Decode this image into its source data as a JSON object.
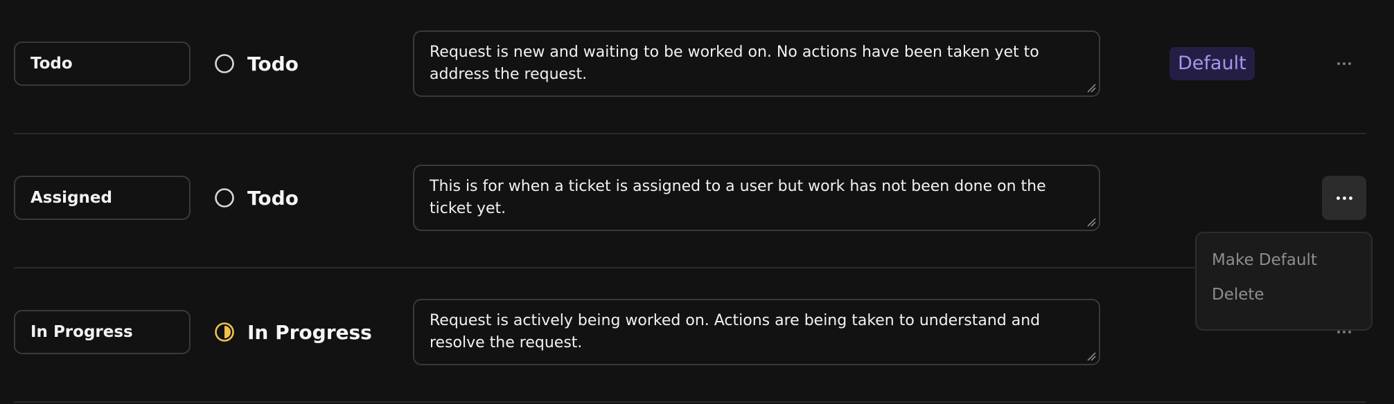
{
  "statuses": [
    {
      "name": "Todo",
      "status_label": "Todo",
      "status_icon": "empty-circle-icon",
      "description": "Request is new and waiting to be worked on. No actions have been taken yet to address the request.",
      "badge": "Default"
    },
    {
      "name": "Assigned",
      "status_label": "Todo",
      "status_icon": "empty-circle-icon",
      "description": "This is for when a ticket is assigned to a user but work has not been done on the ticket yet."
    },
    {
      "name": "In Progress",
      "status_label": "In Progress",
      "status_icon": "half-filled-circle-icon",
      "description": "Request is actively being worked on. Actions are being taken to understand and resolve the request."
    }
  ],
  "menu": {
    "items": [
      "Make Default",
      "Delete"
    ]
  },
  "colors": {
    "background": "#121212",
    "badge_bg": "#251e44",
    "badge_text": "#a895f0",
    "in_progress": "#f2c14e"
  }
}
